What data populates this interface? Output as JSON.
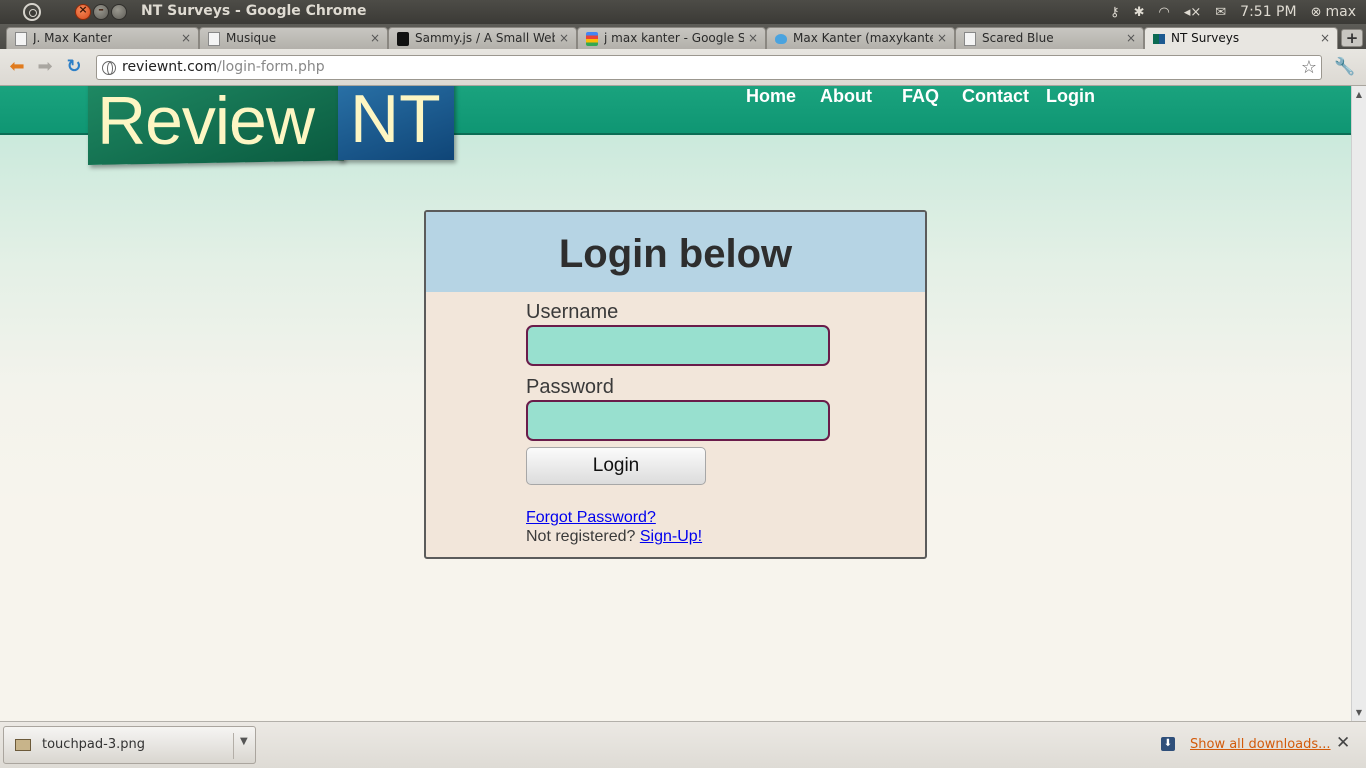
{
  "os_panel": {
    "window_title": "NT Surveys - Google Chrome",
    "time": "7:51 PM",
    "user": "max"
  },
  "tabs": [
    {
      "label": "J. Max Kanter",
      "favicon": "page-icon",
      "left": 0
    },
    {
      "label": "Musique",
      "favicon": "page-icon"
    },
    {
      "label": "Sammy.js / A Small Web Fr",
      "favicon": "sammy-icon"
    },
    {
      "label": "j max kanter - Google Sea",
      "favicon": "google-icon"
    },
    {
      "label": "Max Kanter (maxykanter)",
      "favicon": "twitter-icon"
    },
    {
      "label": "Scared Blue",
      "favicon": "page-icon"
    },
    {
      "label": "NT Surveys",
      "favicon": "nt-icon",
      "active": true
    }
  ],
  "toolbar": {
    "url_host": "reviewnt.com",
    "url_path": "/login-form.php"
  },
  "site": {
    "logo_part1": "Review",
    "logo_part2": "NT",
    "nav": [
      "Home",
      "About",
      "FAQ",
      "Contact",
      "Login"
    ]
  },
  "login": {
    "title": "Login below",
    "username_label": "Username",
    "username_value": "",
    "password_label": "Password",
    "password_value": "",
    "button_label": "Login",
    "forgot_link": "Forgot Password?",
    "not_registered": "Not registered?",
    "signup_link": "Sign-Up!"
  },
  "downloads": {
    "file_name": "touchpad-3.png",
    "show_all": "Show all downloads..."
  }
}
